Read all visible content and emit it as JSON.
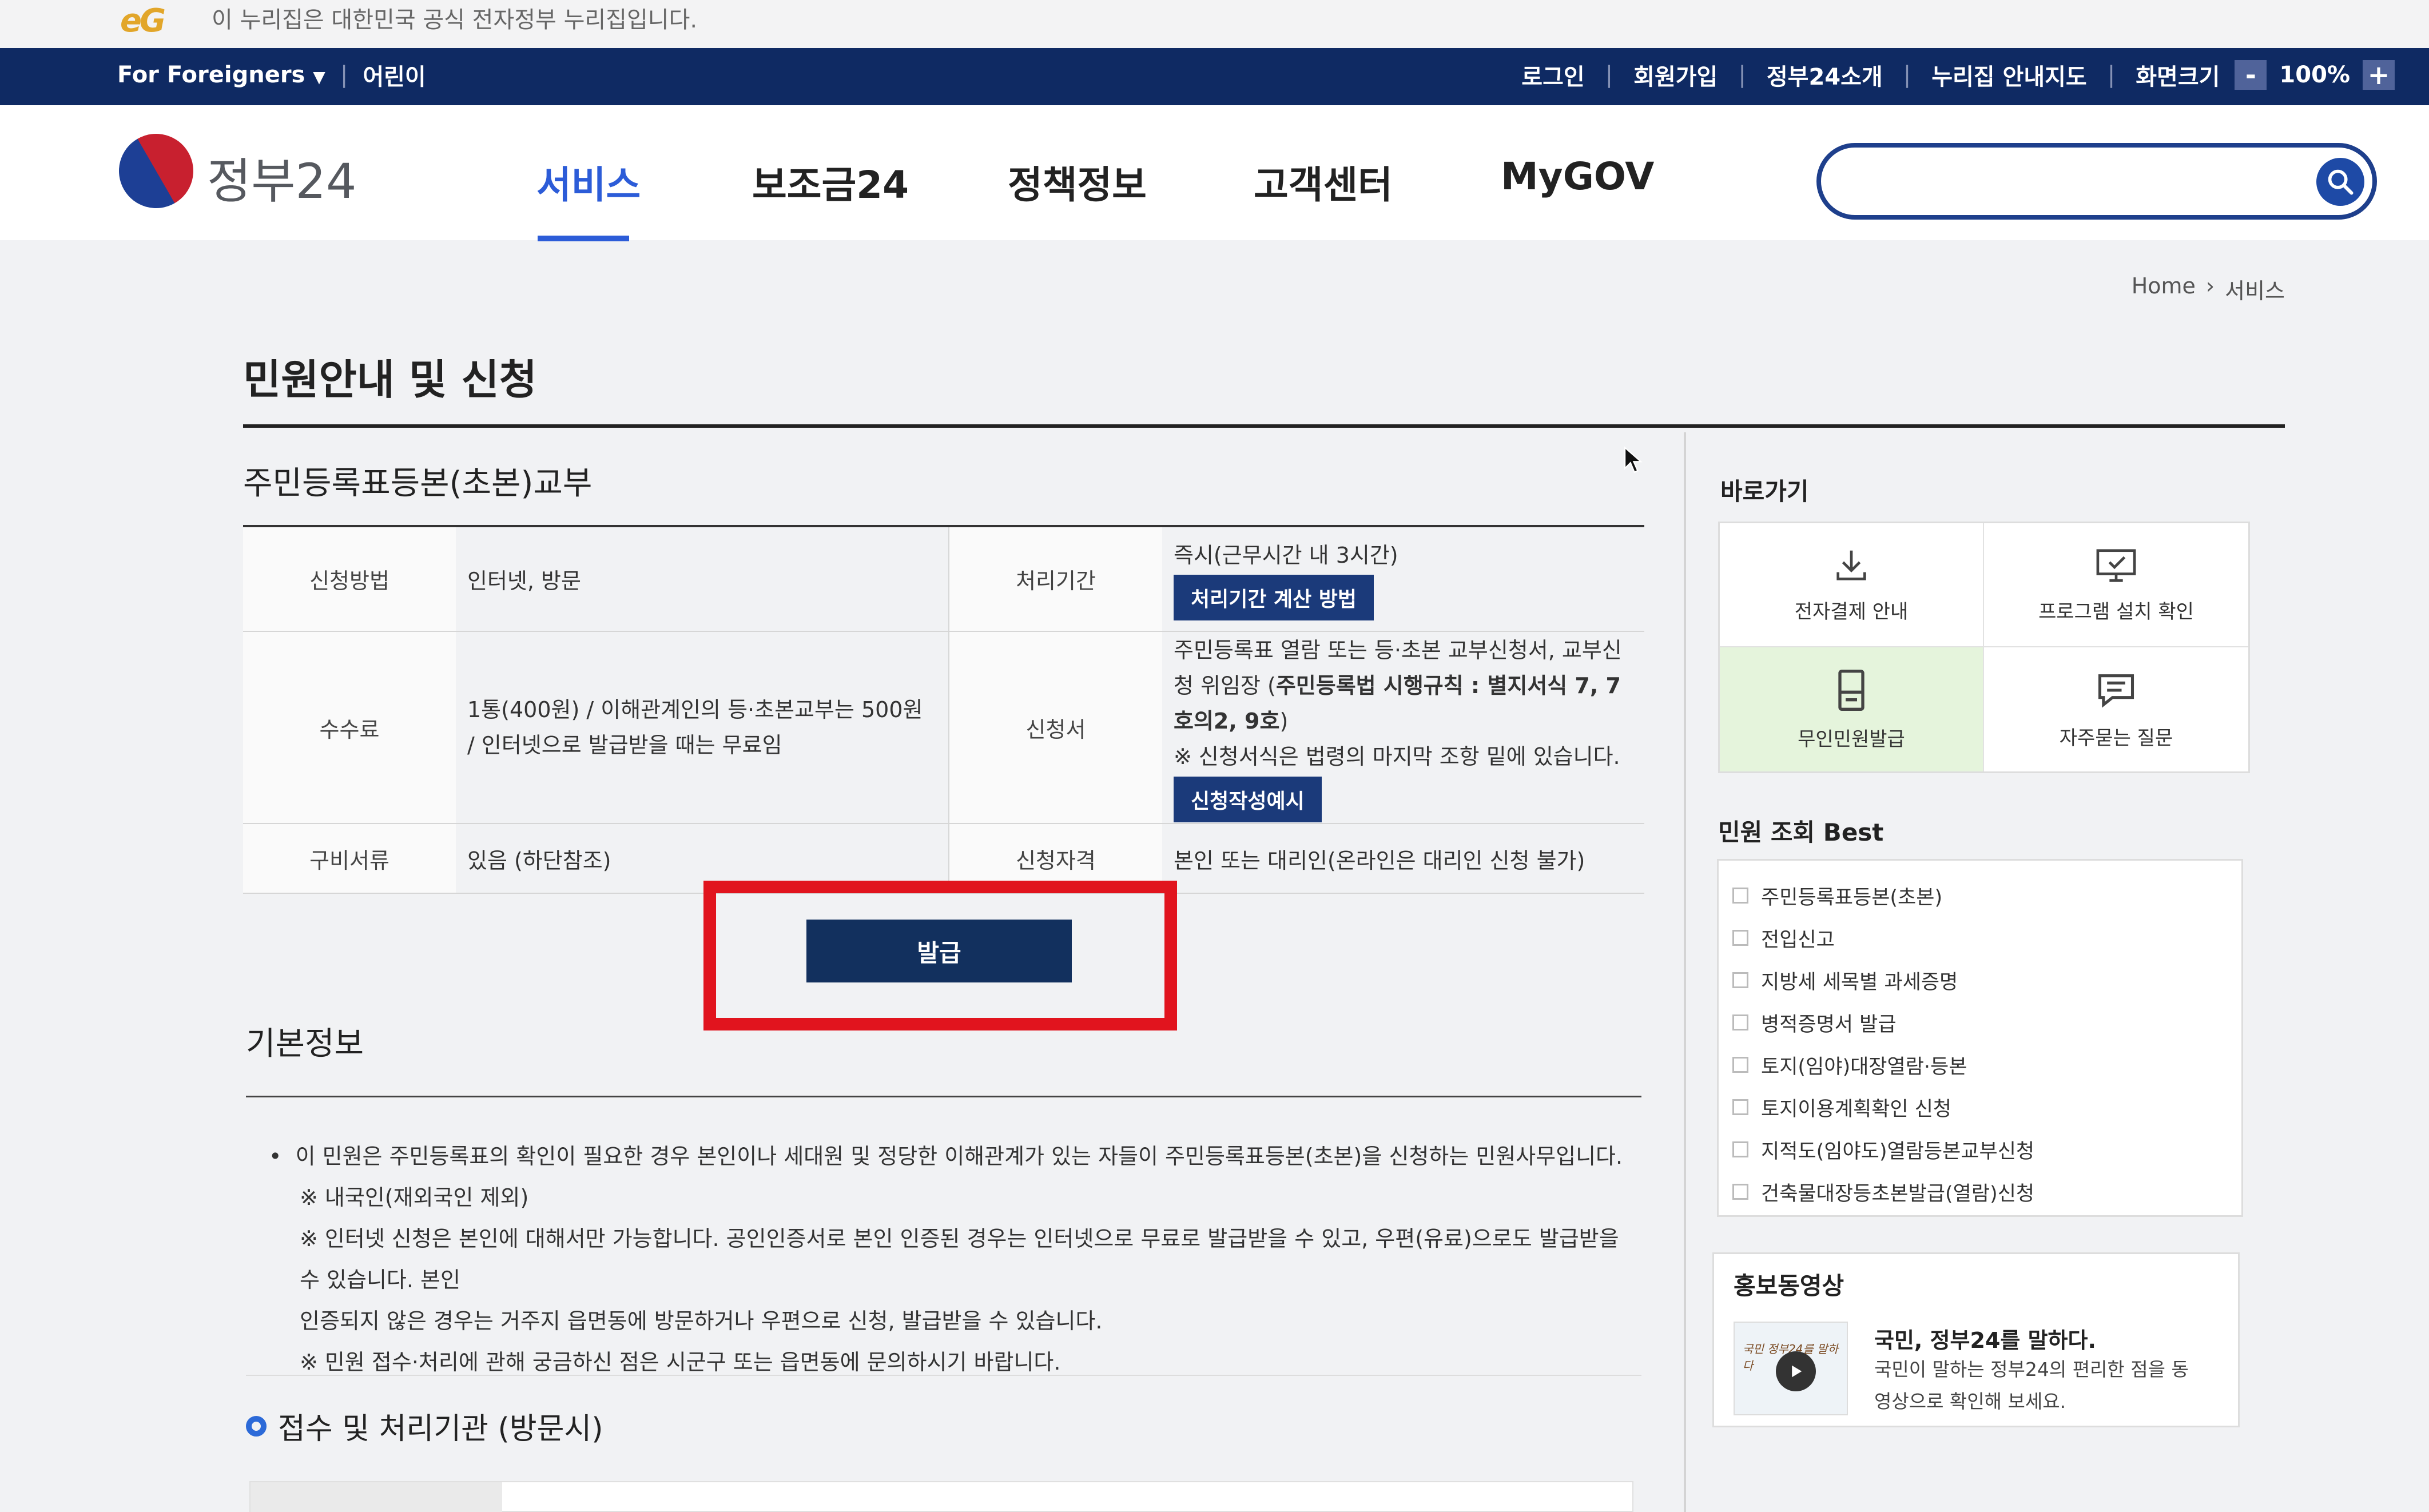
{
  "official_banner": {
    "logo": "eG",
    "text": "이 누리집은 대한민국 공식 전자정부 누리집입니다."
  },
  "utility": {
    "foreigners": "For Foreigners",
    "kids": "어린이",
    "login": "로그인",
    "signup": "회원가입",
    "about": "정부24소개",
    "sitemap": "누리집 안내지도",
    "zoom_label": "화면크기",
    "zoom_minus": "-",
    "zoom_value": "100%",
    "zoom_plus": "+"
  },
  "header": {
    "logo_text": "정부24",
    "nav": [
      "서비스",
      "보조금24",
      "정책정보",
      "고객센터",
      "MyGOV"
    ],
    "search_placeholder": ""
  },
  "breadcrumb": {
    "home": "Home",
    "current": "서비스"
  },
  "page_title": "민원안내 및 신청",
  "service": {
    "title": "주민등록표등본(초본)교부",
    "rows": {
      "method_label": "신청방법",
      "method_value": "인터넷, 방문",
      "period_label": "처리기간",
      "period_value": "즉시(근무시간 내 3시간)",
      "period_button": "처리기간 계산 방법",
      "fee_label": "수수료",
      "fee_value": "1통(400원) / 이해관계인의 등·초본교부는 500원 / 인터넷으로 발급받을 때는 무료임",
      "form_label": "신청서",
      "form_value_1": "주민등록표 열람 또는 등·초본 교부신청서, 교부신청 위임장 (",
      "form_value_bold": "주민등록법 시행규칙 : 별지서식 7, 7호의2, 9호",
      "form_value_2": ")",
      "form_note": "※ 신청서식은 법령의 마지막 조항 밑에 있습니다.",
      "form_button": "신청작성예시",
      "docs_label": "구비서류",
      "docs_value": "있음 (하단참조)",
      "qual_label": "신청자격",
      "qual_value": "본인 또는 대리인(온라인은 대리인 신청 불가)"
    },
    "issue_button": "발급"
  },
  "basic_info": {
    "title": "기본정보",
    "bullet": "이 민원은 주민등록표의 확인이 필요한 경우 본인이나 세대원 및 정당한 이해관계가 있는 자들이 주민등록표등본(초본)을 신청하는 민원사무입니다.",
    "note1": "※ 내국인(재외국인 제외)",
    "note2a": "※ 인터넷 신청은 본인에 대해서만 가능합니다. 공인인증서로 본인 인증된 경우는 인터넷으로 무료로 발급받을 수 있고, 우편(유료)으로도 발급받을 수 있습니다. 본인",
    "note2b": "인증되지 않은 경우는 거주지 읍면동에 방문하거나 우편으로 신청, 발급받을 수 있습니다.",
    "note3": "※ 민원 접수·처리에 관해 궁금하신 점은 시군구 또는 읍면동에 문의하시기 바랍니다."
  },
  "section_sub": "접수 및 처리기관 (방문시)",
  "sidebar": {
    "quick_title": "바로가기",
    "quick": [
      "전자결제 안내",
      "프로그램 설치 확인",
      "무인민원발급",
      "자주묻는 질문"
    ],
    "best_title": "민원 조회 Best",
    "best": [
      "주민등록표등본(초본)",
      "전입신고",
      "지방세 세목별 과세증명",
      "병적증명서 발급",
      "토지(임야)대장열람·등본",
      "토지이용계획확인 신청",
      "지적도(임야도)열람등본교부신청",
      "건축물대장등초본발급(열람)신청"
    ],
    "promo_title": "홍보동영상",
    "promo_thumb_text": "국민 정부24를 말하다",
    "promo_head": "국민, 정부24를 말하다.",
    "promo_desc": "국민이 말하는 정부24의 편리한 점을 동영상으로 확인해 보세요."
  },
  "colors": {
    "navy": "#0f2a63",
    "accent": "#2c5cd8",
    "highlight_red": "#e1141e",
    "quick_highlight": "#e5f4dc"
  }
}
